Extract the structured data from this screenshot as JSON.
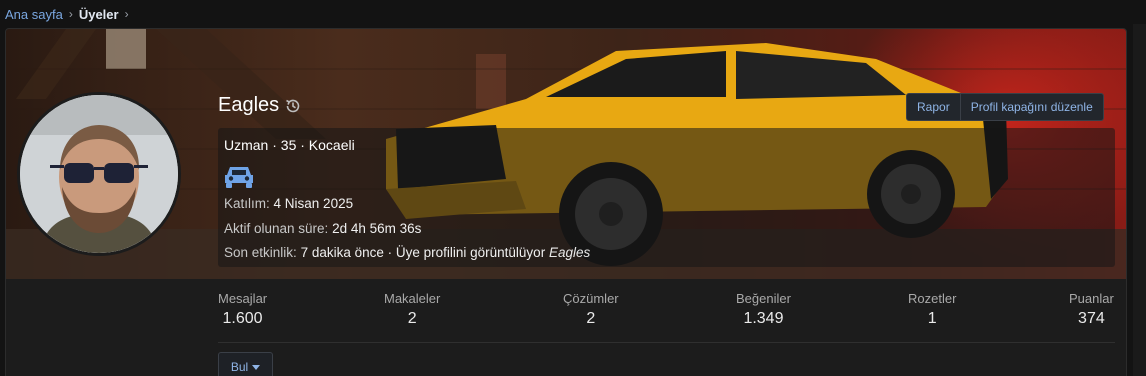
{
  "breadcrumb": {
    "home": "Ana sayfa",
    "current": "Üyeler"
  },
  "cover": {
    "report_label": "Rapor",
    "edit_cover_label": "Profil kapağını düzenle"
  },
  "profile": {
    "username": "Eagles",
    "title_line": "Uzman · 35 · Kocaeli",
    "icon": "car-icon",
    "joined_label": "Katılım:",
    "joined_value": "4 Nisan 2025",
    "active_label": "Aktif olunan süre:",
    "active_value": "2d 4h 56m 36s",
    "last_label": "Son etkinlik:",
    "last_value": "7 dakika önce · Üye profilini görüntülüyor",
    "last_target": "Eagles"
  },
  "stats": [
    {
      "label": "Mesajlar",
      "value": "1.600"
    },
    {
      "label": "Makaleler",
      "value": "2"
    },
    {
      "label": "Çözümler",
      "value": "2"
    },
    {
      "label": "Beğeniler",
      "value": "1.349"
    },
    {
      "label": "Rozetler",
      "value": "1"
    },
    {
      "label": "Puanlar",
      "value": "374"
    }
  ],
  "find_button": "Bul",
  "colors": {
    "accent": "#7aa7e0",
    "background": "#131313",
    "car_icon": "#6fa3e6",
    "car_paint": "#e8a812"
  }
}
